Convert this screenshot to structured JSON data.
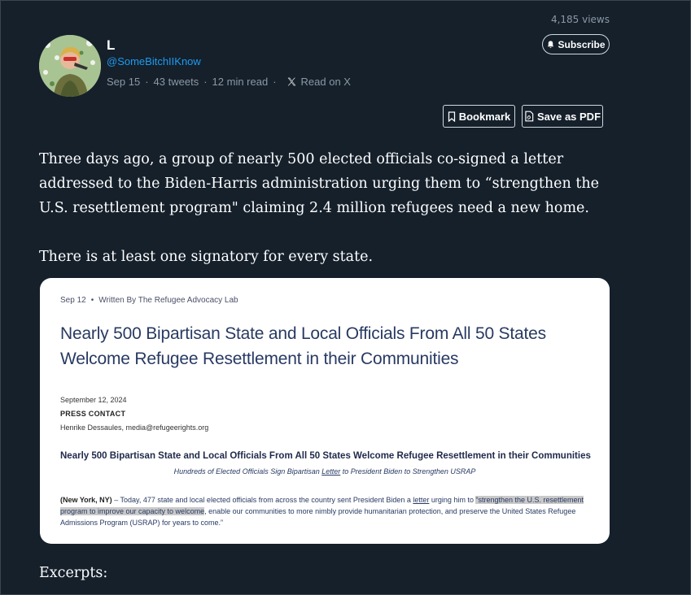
{
  "header": {
    "views": "4,185 views",
    "author_name": "L",
    "handle": "@SomeBitchIIKnow",
    "date": "Sep 15",
    "tweets": "43 tweets",
    "read_time": "12 min read",
    "read_on": "Read on X",
    "dot": "·",
    "subscribe_label": "Subscribe",
    "bookmark_label": "Bookmark",
    "save_pdf_label": "Save as PDF"
  },
  "article": {
    "paragraph1": "Three days ago, a group of nearly 500 elected officials co-signed a letter addressed to the Biden-Harris administration urging them to “strengthen the U.S. resettlement program\" claiming 2.4 million refugees need a new home.",
    "paragraph2": "There is at least one signatory for every state.",
    "paragraph3": "Excerpts:"
  },
  "card": {
    "date": "Sep 12",
    "dot": "•",
    "byline": "Written By The Refugee Advocacy Lab",
    "title": "Nearly 500 Bipartisan State and Local Officials From All 50 States Welcome Refugee Resettlement in their Communities",
    "pr_date": "September 12, 2024",
    "pr_contact_label": "PRESS CONTACT",
    "pr_contact": "Henrike Dessaules, media@refugeerights.org",
    "pr_headline": "Nearly 500 Bipartisan State and Local Officials From All 50 States Welcome Refugee Resettlement in their Communities",
    "pr_sub_before": "Hundreds of Elected Officials Sign Bipartisan ",
    "pr_sub_link": "Letter",
    "pr_sub_after": " to President Biden to Strengthen USRAP",
    "body_location": "(New York, NY)",
    "body_part1": " – Today, 477 state and local elected officials from across the country sent President Biden a ",
    "body_link": "letter",
    "body_part2": " urging him to ",
    "body_highlight": "“strengthen the U.S. resettlement program to improve our capacity to welcome",
    "body_part3": ", enable our communities to more nimbly provide humanitarian protection, and preserve the United States Refugee Admissions Program (USRAP) for years to come.”"
  },
  "colors": {
    "background": "#15202b",
    "handle": "#1d9bf0",
    "card_title": "#283a63",
    "highlight": "#c9c9c9"
  },
  "icons": [
    "bell-icon",
    "x-logo-icon",
    "bookmark-icon",
    "pdf-icon"
  ]
}
